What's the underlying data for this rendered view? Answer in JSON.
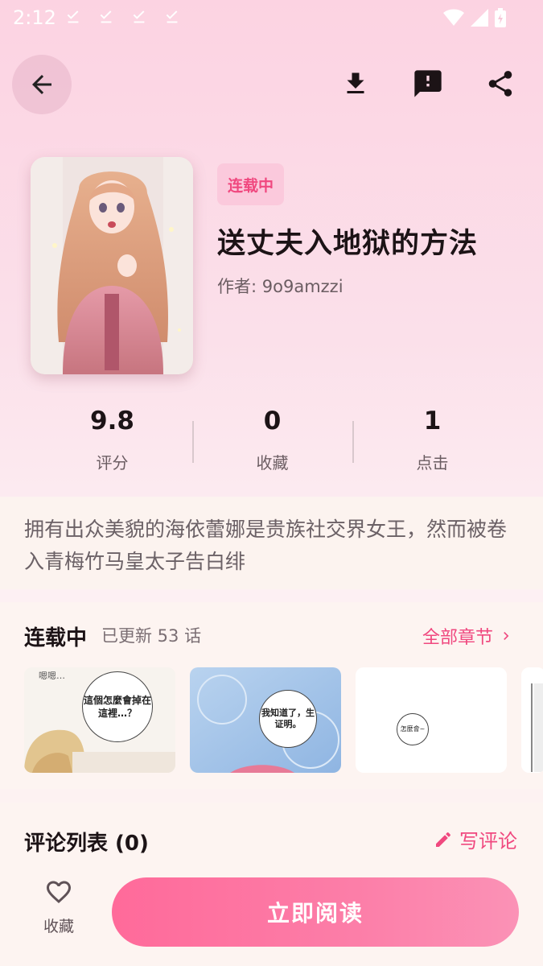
{
  "status_bar": {
    "time": "2:12"
  },
  "book": {
    "status": "连载中",
    "title": "送丈夫入地狱的方法",
    "author": "作者: 9o9amzzi",
    "description": "拥有出众美貌的海依蕾娜是贵族社交界女王，然而被卷入青梅竹马皇太子告白绯"
  },
  "stats": [
    {
      "value": "9.8",
      "label": "评分"
    },
    {
      "value": "0",
      "label": "收藏"
    },
    {
      "value": "1",
      "label": "点击"
    }
  ],
  "chapters": {
    "title": "连载中",
    "count": "已更新 53 话",
    "all_label": "全部章节",
    "thumbnails": [
      {
        "bubble_text": "這個怎麼會掉在這裡…？",
        "top_text": "嗯嗯…"
      },
      {
        "bubble_text": "我知道了，生证明。"
      },
      {
        "bubble_text": "怎麼會~"
      }
    ]
  },
  "comments": {
    "title": "评论列表 (0)",
    "write_label": "写评论"
  },
  "bottom": {
    "favorite_label": "收藏",
    "read_label": "立即阅读"
  },
  "colors": {
    "accent": "#f0487f",
    "badge_bg": "#fbc9dc"
  }
}
